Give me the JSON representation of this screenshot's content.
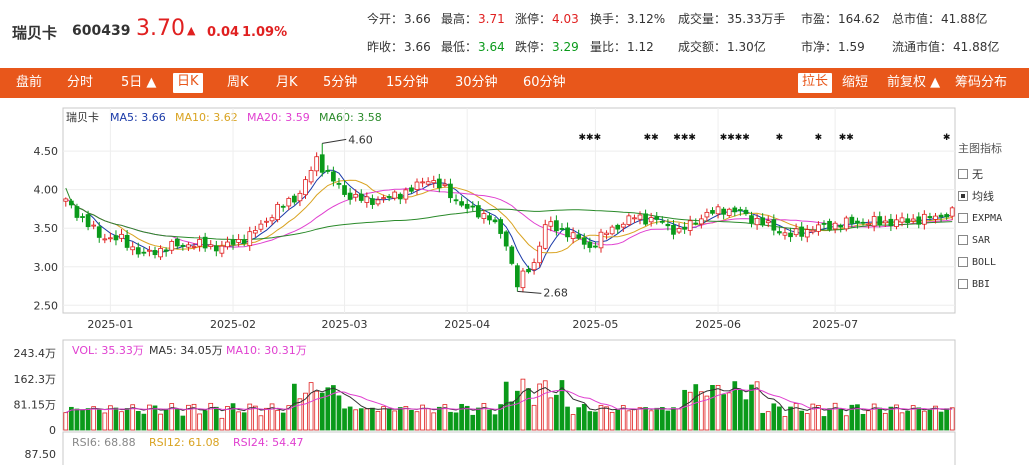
{
  "stock": {
    "name": "瑞贝卡",
    "code": "600439",
    "price": "3.70",
    "arrow": "▲",
    "change": "0.04",
    "change_pct": "1.09%"
  },
  "quote": [
    {
      "label": "今开：",
      "value": "3.66",
      "tone": ""
    },
    {
      "label": "最高：",
      "value": "3.71",
      "tone": "red"
    },
    {
      "label": "涨停：",
      "value": "4.03",
      "tone": "red"
    },
    {
      "label": "换手：",
      "value": "3.12%",
      "tone": ""
    },
    {
      "label": "成交量：",
      "value": "35.33万手",
      "tone": ""
    },
    {
      "label": "市盈：",
      "value": "164.62",
      "tone": ""
    },
    {
      "label": "总市值：",
      "value": "41.88亿",
      "tone": ""
    },
    {
      "label": "昨收：",
      "value": "3.66",
      "tone": ""
    },
    {
      "label": "最低：",
      "value": "3.64",
      "tone": "green"
    },
    {
      "label": "跌停：",
      "value": "3.29",
      "tone": "green"
    },
    {
      "label": "量比：",
      "value": "1.12",
      "tone": ""
    },
    {
      "label": "成交额：",
      "value": "1.30亿",
      "tone": ""
    },
    {
      "label": "市净：",
      "value": "1.59",
      "tone": ""
    },
    {
      "label": "流通市值：",
      "value": "41.88亿",
      "tone": ""
    }
  ],
  "toolbar": {
    "items": [
      "盘前",
      "分时",
      "5日 ▲",
      "日K",
      "周K",
      "月K",
      "5分钟",
      "15分钟",
      "30分钟",
      "60分钟"
    ],
    "active": "日K",
    "right": [
      "拉长",
      "缩短",
      "前复权 ▲",
      "筹码分布"
    ],
    "right_active": "拉长"
  },
  "indicator_panel": {
    "title": "主图指标",
    "items": [
      {
        "label": "无",
        "checked": false
      },
      {
        "label": "均线",
        "checked": true
      },
      {
        "label": "EXPMA",
        "checked": false
      },
      {
        "label": "SAR",
        "checked": false
      },
      {
        "label": "BOLL",
        "checked": false
      },
      {
        "label": "BBI",
        "checked": false
      }
    ]
  },
  "colors": {
    "up": "#e02020",
    "down": "#0a9a1a",
    "ma5": "#1a3aa8",
    "ma10": "#d9a321",
    "ma20": "#e040d0",
    "ma60": "#2a8a2a",
    "accent": "#e8571b"
  },
  "chart_data": {
    "type": "candlestick",
    "title": "瑞贝卡",
    "legend": [
      {
        "name": "MA5",
        "value": "3.66",
        "color": "#1a3aa8"
      },
      {
        "name": "MA10",
        "value": "3.62",
        "color": "#d9a321"
      },
      {
        "name": "MA20",
        "value": "3.59",
        "color": "#e040d0"
      },
      {
        "name": "MA60",
        "value": "3.58",
        "color": "#2a8a2a"
      }
    ],
    "y_ticks": [
      "4.50",
      "4.00",
      "3.50",
      "3.00",
      "2.50"
    ],
    "y_tick_values": [
      4.5,
      4.0,
      3.5,
      3.0,
      2.5
    ],
    "ylim": [
      2.4,
      4.8
    ],
    "x_labels": [
      "2025-01",
      "2025-02",
      "2025-03",
      "2025-04",
      "2025-05",
      "2025-06",
      "2025-07"
    ],
    "x_label_index": [
      8,
      30,
      50,
      72,
      95,
      117,
      138
    ],
    "num_bars": 160,
    "anchors": [
      [
        0,
        3.85
      ],
      [
        6,
        3.4
      ],
      [
        10,
        3.35
      ],
      [
        14,
        3.15
      ],
      [
        18,
        3.25
      ],
      [
        22,
        3.3
      ],
      [
        28,
        3.25
      ],
      [
        33,
        3.4
      ],
      [
        38,
        3.75
      ],
      [
        42,
        3.95
      ],
      [
        45,
        4.4
      ],
      [
        47,
        4.2
      ],
      [
        50,
        3.95
      ],
      [
        54,
        3.85
      ],
      [
        58,
        3.9
      ],
      [
        62,
        4.0
      ],
      [
        65,
        4.15
      ],
      [
        68,
        4.0
      ],
      [
        72,
        3.75
      ],
      [
        76,
        3.65
      ],
      [
        79,
        3.3
      ],
      [
        81,
        2.78
      ],
      [
        84,
        3.05
      ],
      [
        86,
        3.55
      ],
      [
        90,
        3.45
      ],
      [
        94,
        3.25
      ],
      [
        97,
        3.45
      ],
      [
        102,
        3.65
      ],
      [
        106,
        3.6
      ],
      [
        110,
        3.45
      ],
      [
        114,
        3.65
      ],
      [
        118,
        3.75
      ],
      [
        121,
        3.7
      ],
      [
        124,
        3.6
      ],
      [
        127,
        3.5
      ],
      [
        130,
        3.4
      ],
      [
        134,
        3.5
      ],
      [
        138,
        3.55
      ],
      [
        142,
        3.58
      ],
      [
        148,
        3.58
      ],
      [
        154,
        3.62
      ],
      [
        159,
        3.7
      ]
    ],
    "annotations": [
      {
        "label": "4.60",
        "index": 46,
        "value": 4.6
      },
      {
        "label": "2.68",
        "index": 81,
        "value": 2.68
      }
    ],
    "star_markers": [
      "✱✱✱",
      "✱✱",
      "✱✱✱",
      "✱✱✱✱",
      "✱",
      "✱",
      "✱✱",
      "✱"
    ],
    "star_index": [
      94,
      105,
      111,
      120,
      128,
      135,
      140,
      158
    ],
    "volume": {
      "legend": [
        {
          "name": "VOL",
          "value": "35.33万",
          "color": "#e040d0"
        },
        {
          "name": "MA5",
          "value": "34.05万",
          "color": "#333333"
        },
        {
          "name": "MA10",
          "value": "30.31万",
          "color": "#e040d0"
        }
      ],
      "y_ticks": [
        "243.4万",
        "162.3万",
        "81.15万",
        "0"
      ],
      "y_tick_values": [
        243.4,
        162.3,
        81.15,
        0
      ],
      "ymax": 260
    },
    "rsi": {
      "legend": [
        {
          "name": "RSI6",
          "value": "68.88",
          "color": "#888888"
        },
        {
          "name": "RSI12",
          "value": "61.08",
          "color": "#d9a321"
        },
        {
          "name": "RSI24",
          "value": "54.47",
          "color": "#e040d0"
        }
      ],
      "y_ticks": [
        "87.50"
      ]
    }
  }
}
